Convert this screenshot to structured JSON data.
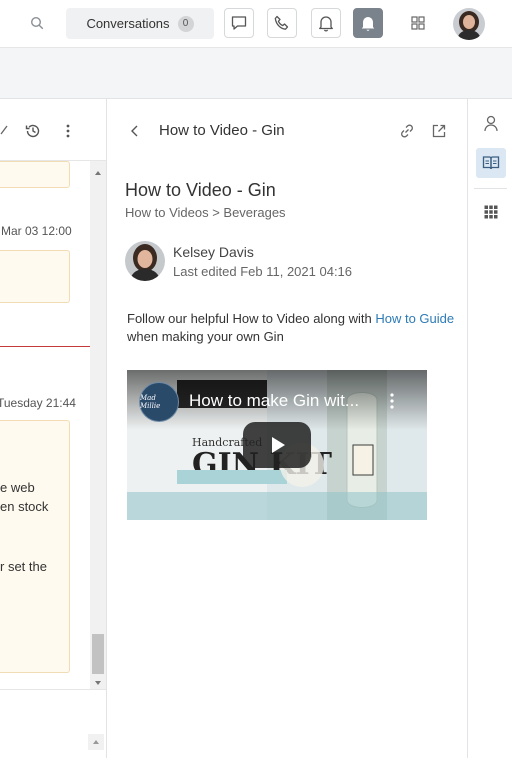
{
  "topbar": {
    "search_icon": "search-icon",
    "conversations_label": "Conversations",
    "conversations_count": "0",
    "icons": [
      "chat-icon",
      "phone-icon",
      "bell-icon",
      "notification-bell-icon",
      "apps-grid-icon"
    ],
    "active_color": "#7a828c"
  },
  "left_pane": {
    "time_1": "Mar 03 12:00",
    "time_2": "Tuesday 21:44",
    "msg_line_1": "e web",
    "msg_line_2": "en stock",
    "msg_line_3": "r set the"
  },
  "article": {
    "header_title": "How to Video - Gin",
    "title": "How to Video - Gin",
    "breadcrumb": "How to Videos > Beverages",
    "author_name": "Kelsey Davis",
    "last_edited": "Last edited Feb 11, 2021 04:16",
    "body_prefix": "Follow our helpful How to Video along with ",
    "body_link": "How to Guide",
    "body_suffix": " when making your own Gin",
    "link_color": "#2d7bb6",
    "video": {
      "title": "How to make Gin wit...",
      "logo_text": "Mad Millie",
      "bg_text_1": "Handcrafted",
      "bg_text_2": "GIN KIT"
    }
  },
  "right_rail": {
    "icons": [
      "person-icon",
      "knowledge-book-icon",
      "apps-grid-icon"
    ],
    "active_color": "#dbe7f2"
  }
}
